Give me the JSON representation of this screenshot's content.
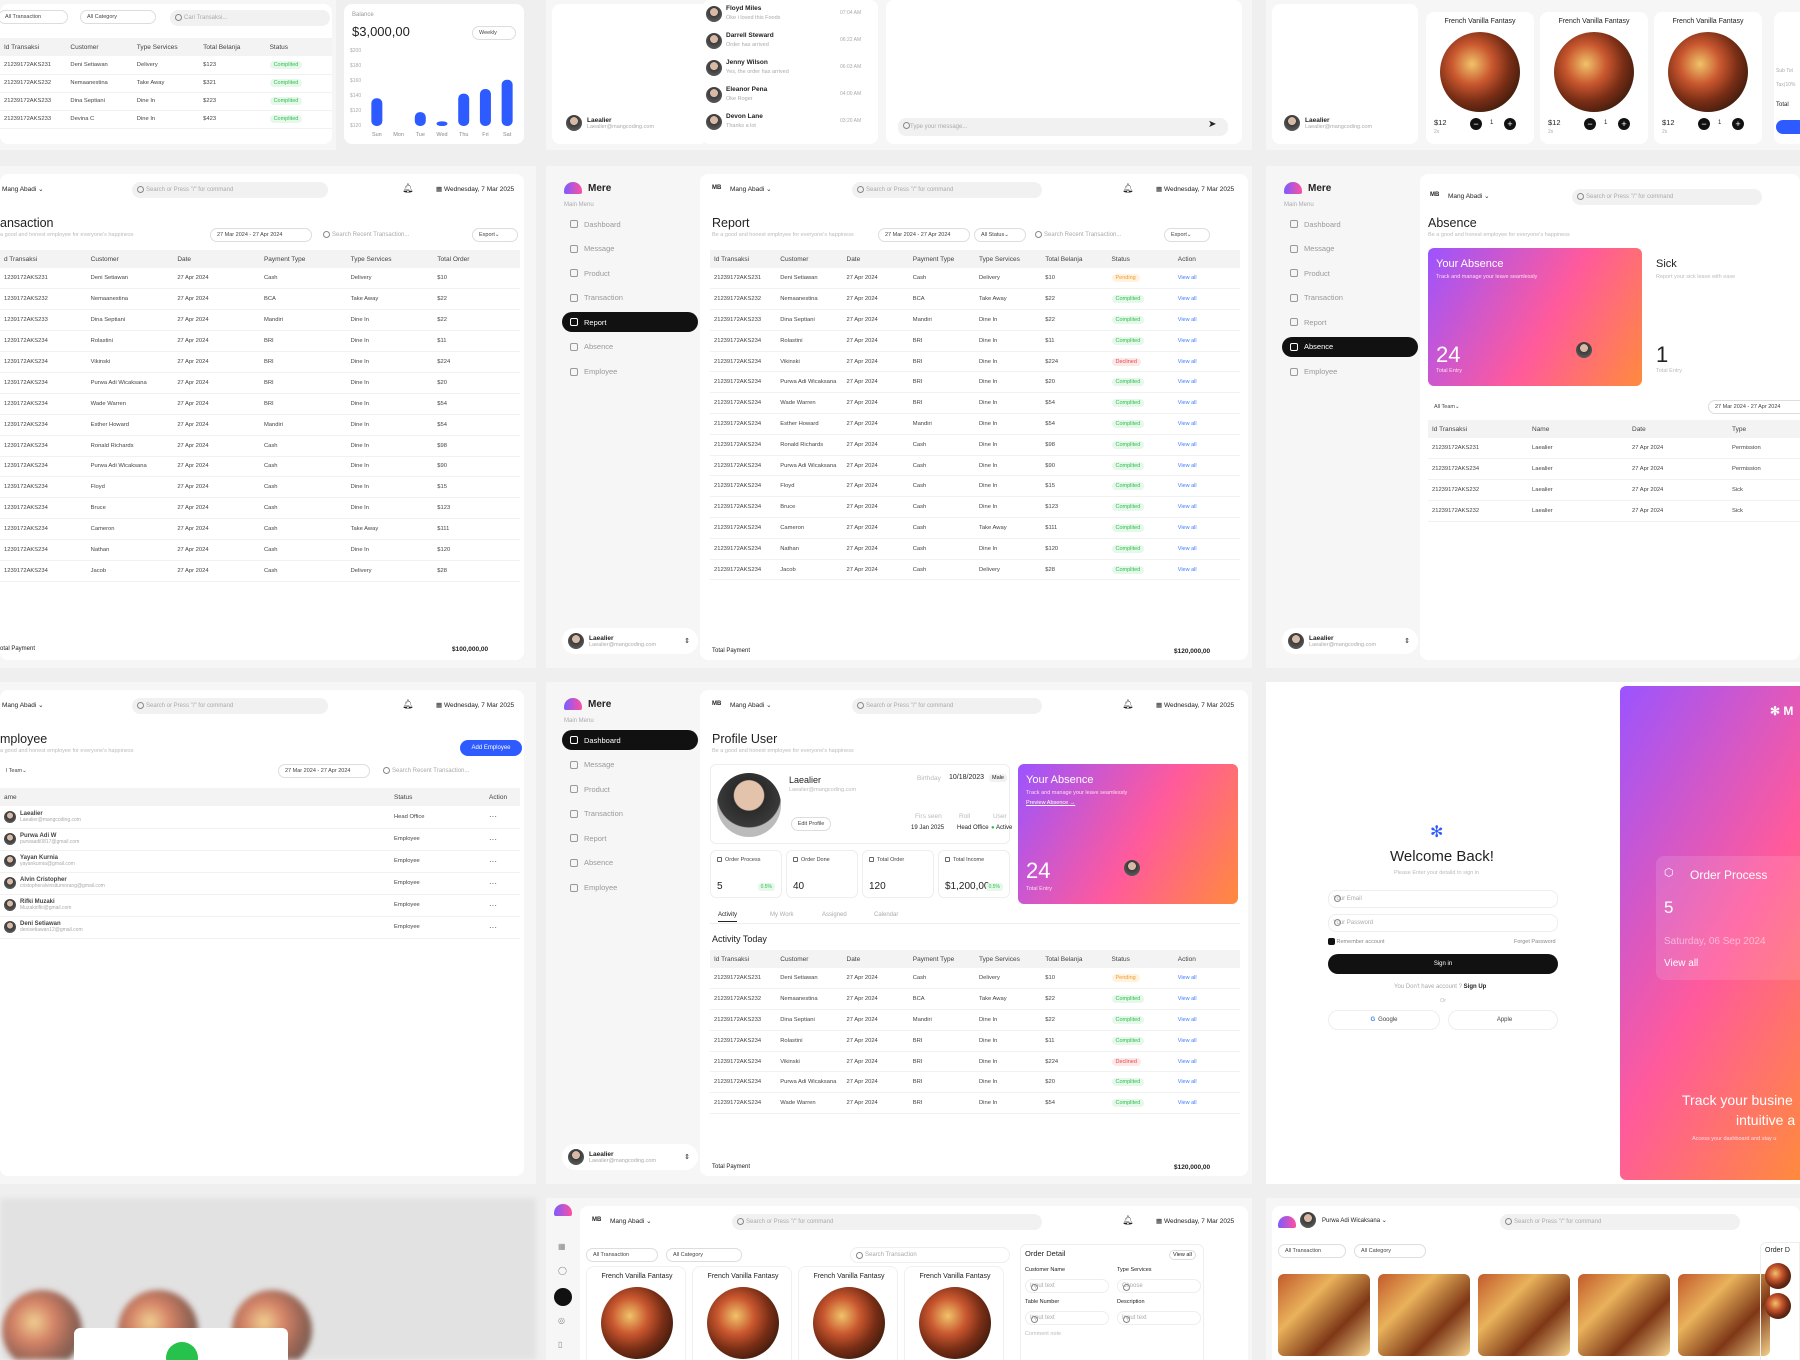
{
  "nav": {
    "brand": "Mere",
    "main_menu": "Main Menu",
    "items": [
      "Dashboard",
      "Message",
      "Product",
      "Transaction",
      "Report",
      "Absence",
      "Employee"
    ]
  },
  "user": {
    "name": "Laealier",
    "email": "Laealier@mangcoding.com"
  },
  "topbar": {
    "initials": "MB",
    "account": "Mang Abadi",
    "search_placeholder": "Search or Press \"/\" for command",
    "date": "Wednesday, 7 Mar 2025"
  },
  "tx1": {
    "filter1": "All Transaction",
    "filter2": "All Category",
    "search": "Cari Transaksi...",
    "headers": [
      "Id Transaksi",
      "Customer",
      "Type Services",
      "Total Belanja",
      "Status"
    ],
    "rows": [
      [
        "21239172AKS231",
        "Deni Setiawan",
        "Delivery",
        "$123",
        "Complited"
      ],
      [
        "21239172AKS232",
        "Nemaanestina",
        "Take Away",
        "$321",
        "Complited"
      ],
      [
        "21239172AKS233",
        "Dina Septiani",
        "Dine In",
        "$223",
        "Complited"
      ],
      [
        "21239172AKS233",
        "Devina C",
        "Dine In",
        "$423",
        "Complited"
      ]
    ]
  },
  "balance": {
    "label": "Balance",
    "value": "$3,000,00",
    "period": "Weekly",
    "yticks": [
      "$200",
      "$180",
      "$160",
      "$140",
      "$120",
      "$120"
    ],
    "days": [
      "Sun",
      "Mon",
      "Tue",
      "Wed",
      "Thu",
      "Fri",
      "Sat"
    ]
  },
  "chart_data": {
    "type": "bar",
    "categories": [
      "Sun",
      "Mon",
      "Tue",
      "Wed",
      "Thu",
      "Fri",
      "Sat"
    ],
    "values": [
      150,
      120,
      135,
      125,
      155,
      160,
      170
    ],
    "title": "",
    "ylabel": "",
    "ylim": [
      120,
      200
    ]
  },
  "chat": {
    "items": [
      {
        "n": "Floyd Miles",
        "m": "Oke i loved this Foods",
        "t": "07:04 AM"
      },
      {
        "n": "Darrell Steward",
        "m": "Order has arrived",
        "t": "06:22 AM"
      },
      {
        "n": "Jenny Wilson",
        "m": "Yes, the order has arrived",
        "t": "06:03 AM"
      },
      {
        "n": "Eleanor Pena",
        "m": "Oke Roger",
        "t": "04:00 AM"
      },
      {
        "n": "Devon Lane",
        "m": "Thanks a lot",
        "t": "03:20 AM"
      }
    ],
    "placeholder": "Type your message..."
  },
  "products": {
    "name": "French Vanilla Fantasy",
    "price": "$12",
    "qty": "1",
    "note": "2x"
  },
  "cart": {
    "sub": "Sub Tot",
    "tax": "Tax(10%",
    "total": "Total"
  },
  "txpage": {
    "title": "ansaction",
    "subtitle": "a good and honest employee for everyone's happiness",
    "range": "27 Mar 2024 - 27 Apr 2024",
    "search": "Search Recent Transaction...",
    "export": "Export",
    "headers": [
      "d Transaksi",
      "Customer",
      "Date",
      "Payment Type",
      "Type Services",
      "Total Order"
    ],
    "rows": [
      [
        "1239172AKS231",
        "Deni Setiawan",
        "27 Apr 2024",
        "Cash",
        "Delivery",
        "$10"
      ],
      [
        "1239172AKS232",
        "Nemaanestina",
        "27 Apr 2024",
        "BCA",
        "Take Away",
        "$22"
      ],
      [
        "1239172AKS233",
        "Dina Septiani",
        "27 Apr 2024",
        "Mandiri",
        "Dine In",
        "$22"
      ],
      [
        "1239172AKS234",
        "Rolastini",
        "27 Apr 2024",
        "BRI",
        "Dine In",
        "$11"
      ],
      [
        "1239172AKS234",
        "Vikinski",
        "27 Apr 2024",
        "BRI",
        "Dine In",
        "$224"
      ],
      [
        "1239172AKS234",
        "Purwa Adi Wicaksana",
        "27 Apr 2024",
        "BRI",
        "Dine In",
        "$20"
      ],
      [
        "1239172AKS234",
        "Wade Warren",
        "27 Apr 2024",
        "BRI",
        "Dine In",
        "$54"
      ],
      [
        "1239172AKS234",
        "Esther Howard",
        "27 Apr 2024",
        "Mandiri",
        "Dine In",
        "$54"
      ],
      [
        "1239172AKS234",
        "Ronald Richards",
        "27 Apr 2024",
        "Cash",
        "Dine In",
        "$98"
      ],
      [
        "1239172AKS234",
        "Purwa Adi Wicaksana",
        "27 Apr 2024",
        "Cash",
        "Dine In",
        "$90"
      ],
      [
        "1239172AKS234",
        "Floyd",
        "27 Apr 2024",
        "Cash",
        "Dine In",
        "$15"
      ],
      [
        "1239172AKS234",
        "Bruce",
        "27 Apr 2024",
        "Cash",
        "Dine In",
        "$123"
      ],
      [
        "1239172AKS234",
        "Cameron",
        "27 Apr 2024",
        "Cash",
        "Take Away",
        "$111"
      ],
      [
        "1239172AKS234",
        "Nathan",
        "27 Apr 2024",
        "Cash",
        "Dine In",
        "$120"
      ],
      [
        "1239172AKS234",
        "Jacob",
        "27 Apr 2024",
        "Cash",
        "Delivery",
        "$28"
      ]
    ],
    "footer_label": "otal Payment",
    "footer_total": "$100,000,00"
  },
  "report": {
    "title": "Report",
    "subtitle": "Be a good and honest employee for everyone's happiness",
    "range": "27 Mar 2024 - 27 Apr 2024",
    "status": "All Status",
    "search": "Search Recent Transaction...",
    "export": "Export",
    "headers": [
      "Id Transaksi",
      "Customer",
      "Date",
      "Payment Type",
      "Type Services",
      "Total Belanja",
      "Status",
      "Action"
    ],
    "rows": [
      [
        "21239172AKS231",
        "Deni Setiawan",
        "27 Apr 2024",
        "Cash",
        "Delivery",
        "$10",
        "Pending"
      ],
      [
        "21239172AKS232",
        "Nemaanestina",
        "27 Apr 2024",
        "BCA",
        "Take Away",
        "$22",
        "Complited"
      ],
      [
        "21239172AKS233",
        "Dina Septiani",
        "27 Apr 2024",
        "Mandiri",
        "Dine In",
        "$22",
        "Complited"
      ],
      [
        "21239172AKS234",
        "Rolastini",
        "27 Apr 2024",
        "BRI",
        "Dine In",
        "$11",
        "Complited"
      ],
      [
        "21239172AKS234",
        "Vikinski",
        "27 Apr 2024",
        "BRI",
        "Dine In",
        "$224",
        "Declined"
      ],
      [
        "21239172AKS234",
        "Purwa Adi Wicaksana",
        "27 Apr 2024",
        "BRI",
        "Dine In",
        "$20",
        "Complited"
      ],
      [
        "21239172AKS234",
        "Wade Warren",
        "27 Apr 2024",
        "BRI",
        "Dine In",
        "$54",
        "Complited"
      ],
      [
        "21239172AKS234",
        "Esther Howard",
        "27 Apr 2024",
        "Mandiri",
        "Dine In",
        "$54",
        "Complited"
      ],
      [
        "21239172AKS234",
        "Ronald Richards",
        "27 Apr 2024",
        "Cash",
        "Dine In",
        "$98",
        "Complited"
      ],
      [
        "21239172AKS234",
        "Purwa Adi Wicaksana",
        "27 Apr 2024",
        "Cash",
        "Dine In",
        "$90",
        "Complited"
      ],
      [
        "21239172AKS234",
        "Floyd",
        "27 Apr 2024",
        "Cash",
        "Dine In",
        "$15",
        "Complited"
      ],
      [
        "21239172AKS234",
        "Bruce",
        "27 Apr 2024",
        "Cash",
        "Dine In",
        "$123",
        "Complited"
      ],
      [
        "21239172AKS234",
        "Cameron",
        "27 Apr 2024",
        "Cash",
        "Take Away",
        "$111",
        "Complited"
      ],
      [
        "21239172AKS234",
        "Nathan",
        "27 Apr 2024",
        "Cash",
        "Dine In",
        "$120",
        "Complited"
      ],
      [
        "21239172AKS234",
        "Jacob",
        "27 Apr 2024",
        "Cash",
        "Delivery",
        "$28",
        "Complited"
      ]
    ],
    "action": "View all",
    "footer_label": "Total Payment",
    "footer_total": "$120,000,00"
  },
  "absence": {
    "title": "Absence",
    "subtitle": "Be a good and honest employee for everyone's happiness",
    "card_title": "Your Absence",
    "card_sub": "Track and manage your leave seamlessly",
    "count": "24",
    "count_label": "Total Entry",
    "sick_title": "Sick",
    "sick_sub": "Report your sick leave with ease",
    "sick_count": "1",
    "sick_label": "Total Entry",
    "team": "All Team",
    "range": "27 Mar 2024 - 27 Apr 2024",
    "headers": [
      "Id Transaksi",
      "Name",
      "Date",
      "Type"
    ],
    "rows": [
      [
        "21239172AKS231",
        "Laealier",
        "27 Apr 2024",
        "Permission"
      ],
      [
        "21239172AKS234",
        "Laealier",
        "27 Apr 2024",
        "Permission"
      ],
      [
        "21239172AKS232",
        "Laealier",
        "27 Apr 2024",
        "Sick"
      ],
      [
        "21239172AKS232",
        "Laealier",
        "27 Apr 2024",
        "Sick"
      ]
    ]
  },
  "employee": {
    "title": "mployee",
    "subtitle": "a good and honest employee for everyone's happiness",
    "team": "l Team",
    "range": "27 Mar 2024 - 27 Apr 2024",
    "search": "Search Recent Transaction...",
    "add": "Add Employee",
    "headers": [
      "ame",
      "Status",
      "Action"
    ],
    "rows": [
      [
        "Laealier",
        "Laealier@mangcoding.com",
        "Head Office"
      ],
      [
        "Purwa Adi W",
        "purwaadi0817@gmail.com",
        "Employee"
      ],
      [
        "Yayan Kurnia",
        "yayankurnia@gmail.com",
        "Employee"
      ],
      [
        "Alvin Cristopher",
        "cristopheralvinsitumorang@gmail.com",
        "Employee"
      ],
      [
        "Rifki Muzaki",
        "Muzakirifki@gmail.com",
        "Employee"
      ],
      [
        "Deni Setiawan",
        "denisetiawan12@gmail.com",
        "Employee"
      ]
    ]
  },
  "profile": {
    "title": "Profile User",
    "subtitle": "Be a good and honest employee for everyone's happiness",
    "name": "Laealier",
    "email": "Laealier@mangcoding.com",
    "birthday_label": "Birthday",
    "birthday": "10/18/2023",
    "gender": "Male",
    "edit": "Edit Profile",
    "first_seen_label": "Firs seen",
    "first_seen": "19 Jan 2025",
    "roll_label": "Roll",
    "roll": "Head Office",
    "user_label": "User",
    "user_status": "Active",
    "absence_title": "Your Absence",
    "absence_sub": "Track and manage your leave seamlessly",
    "absence_link": "Preview Absence",
    "absence_count": "24",
    "absence_label": "Total Entry",
    "kpis": [
      {
        "l": "Order Process",
        "v": "5",
        "c": "0.5%"
      },
      {
        "l": "Order Done",
        "v": "40",
        "c": ""
      },
      {
        "l": "Total Order",
        "v": "120",
        "c": ""
      },
      {
        "l": "Total Income",
        "v": "$1,200,00",
        "c": "0.5%"
      }
    ],
    "tabs": [
      "Activity",
      "My Work",
      "Assigned",
      "Calendar"
    ],
    "activity": "Activity Today"
  },
  "login": {
    "title": "Welcome Back!",
    "sub": "Please Enter your detaild to sign in",
    "email": "Your Email",
    "password": "Your Password",
    "remember": "Remember account",
    "forgot": "Forget Password",
    "signin": "Sign in",
    "noacc": "You Don't have account ?",
    "signup": "Sign Up",
    "or": "Or",
    "google": "Google",
    "apple": "Apple",
    "promo_brand": "M",
    "promo_title": "Order Process",
    "promo_value": "5",
    "promo_date": "Saturday, 06 Sep 2024",
    "promo_link": "View all",
    "promo_h": "Track your busine",
    "promo_h2": "intuitive a",
    "promo_s": "Access your dashboard and stay u"
  },
  "pos": {
    "filter1": "All Transaction",
    "filter2": "All Category",
    "search": "Search Transaction",
    "od_title": "Order Detail",
    "od_view": "View all",
    "cust": "Customer Name",
    "type": "Type Services",
    "input": "Input text",
    "choose": "Choose",
    "table": "Table Number",
    "desc": "Description",
    "comment": "Comment note",
    "cust2": "Purwa Adi Wicaksana",
    "order": "Order D"
  },
  "colors": {
    "accent": "#2e5bff",
    "dark": "#111111",
    "complete": "#2fbf4d",
    "pending": "#f29a2a",
    "declined": "#e64545"
  }
}
